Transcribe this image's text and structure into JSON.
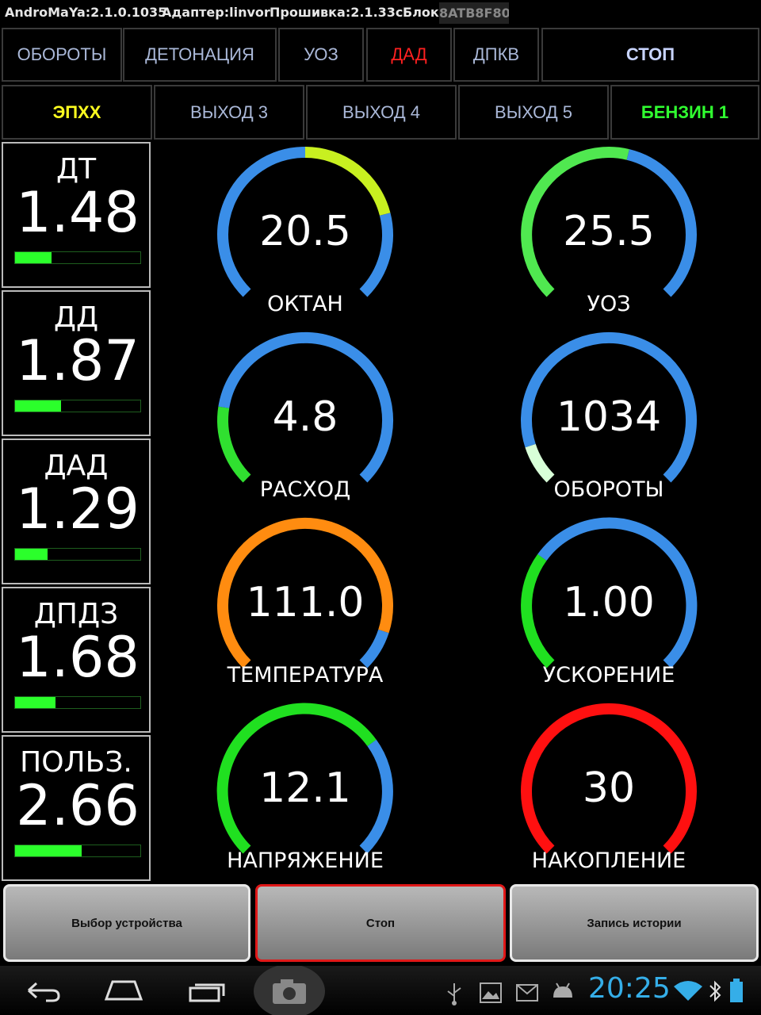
{
  "titlebar": {
    "app": "AndroMaYa:2.1.0.1035",
    "adapter": "Адаптер:linvor",
    "firmware": "Прошивка:2.1.33c",
    "block": "Блок:",
    "block_redacted": "8ATB8F80"
  },
  "tabs_row1": [
    {
      "label": "ОБОРОТЫ",
      "color": "#aab8d8"
    },
    {
      "label": "ДЕТОНАЦИЯ",
      "color": "#aab8d8"
    },
    {
      "label": "УОЗ",
      "color": "#aab8d8"
    },
    {
      "label": "ДАД",
      "color": "#ff2020"
    },
    {
      "label": "ДПКВ",
      "color": "#aab8d8"
    },
    {
      "label": "СТОП",
      "color": "#c8d4ff"
    }
  ],
  "tabs_row2": [
    {
      "label": "ЭПХХ",
      "color": "#ffff20"
    },
    {
      "label": "ВЫХОД 3",
      "color": "#aab8d8"
    },
    {
      "label": "ВЫХОД 4",
      "color": "#aab8d8"
    },
    {
      "label": "ВЫХОД 5",
      "color": "#aab8d8"
    },
    {
      "label": "БЕНЗИН 1",
      "color": "#30ff30"
    }
  ],
  "sensors": [
    {
      "label": "ДТ",
      "value": "1.48",
      "level": 0.29
    },
    {
      "label": "ДД",
      "value": "1.87",
      "level": 0.37
    },
    {
      "label": "ДАД",
      "value": "1.29",
      "level": 0.26
    },
    {
      "label": "ДПДЗ",
      "value": "1.68",
      "level": 0.32
    },
    {
      "label": "ПОЛЬЗ.",
      "value": "2.66",
      "level": 0.53
    }
  ],
  "gauges": [
    {
      "label": "ОКТАН",
      "value": "20.5",
      "segments": [
        {
          "to": 0.5,
          "color": "#3a8ee8"
        },
        {
          "to": 0.78,
          "color": "#c8f020"
        },
        {
          "to": 1,
          "color": "#3a8ee8"
        }
      ]
    },
    {
      "label": "УОЗ",
      "value": "25.5",
      "segments": [
        {
          "to": 0.55,
          "color": "#50e850"
        },
        {
          "to": 1,
          "color": "#3a8ee8"
        }
      ]
    },
    {
      "label": "РАСХОД",
      "value": "4.8",
      "segments": [
        {
          "to": 0.2,
          "color": "#30e030"
        },
        {
          "to": 1,
          "color": "#3a8ee8"
        }
      ]
    },
    {
      "label": "ОБОРОТЫ",
      "value": "1034",
      "segments": [
        {
          "to": 0.1,
          "color": "#d8ffd8"
        },
        {
          "to": 1,
          "color": "#3a8ee8"
        }
      ]
    },
    {
      "label": "ТЕМПЕРАТУРА",
      "value": "111.0",
      "segments": [
        {
          "to": 0.9,
          "color": "#ff8c10"
        },
        {
          "to": 1,
          "color": "#3a8ee8"
        }
      ]
    },
    {
      "label": "УСКОРЕНИЕ",
      "value": "1.00",
      "segments": [
        {
          "to": 0.3,
          "color": "#20e020"
        },
        {
          "to": 1,
          "color": "#3a8ee8"
        }
      ]
    },
    {
      "label": "НАПРЯЖЕНИЕ",
      "value": "12.1",
      "segments": [
        {
          "to": 0.7,
          "color": "#20e020"
        },
        {
          "to": 1,
          "color": "#3a8ee8"
        }
      ]
    },
    {
      "label": "НАКОПЛЕНИЕ",
      "value": "30",
      "segments": [
        {
          "to": 1,
          "color": "#ff1010"
        }
      ]
    }
  ],
  "actions": {
    "select_device": "Выбор устройства",
    "stop": "Стоп",
    "record_history": "Запись истории"
  },
  "status": {
    "time": "20:25"
  }
}
